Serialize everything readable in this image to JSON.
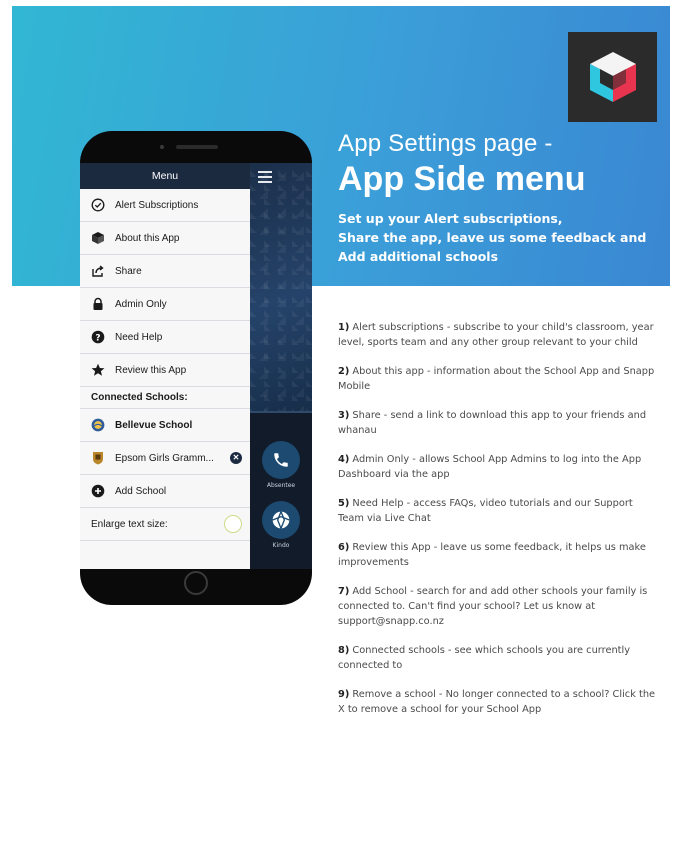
{
  "heading": {
    "subtitle": "App Settings page -",
    "title": "App Side menu",
    "tagline_lines": [
      "Set up your Alert subscriptions,",
      "Share the app, leave us some feedback and",
      "Add additional schools"
    ]
  },
  "logo": {
    "icon": "cube-logo-icon",
    "colors": [
      "#ffffff",
      "#e8344e",
      "#2fc6e0"
    ]
  },
  "phone_menu": {
    "header": "Menu",
    "items": [
      {
        "icon": "check-circle-icon",
        "label": "Alert Subscriptions"
      },
      {
        "icon": "cube-icon",
        "label": "About this App"
      },
      {
        "icon": "share-icon",
        "label": "Share"
      },
      {
        "icon": "lock-icon",
        "label": "Admin Only"
      },
      {
        "icon": "help-icon",
        "label": "Need Help"
      },
      {
        "icon": "star-icon",
        "label": "Review this App"
      }
    ],
    "connected_label": "Connected Schools:",
    "schools": [
      {
        "icon": "school-badge-icon",
        "label": "Bellevue School"
      },
      {
        "icon": "school-crest-icon",
        "label": "Epsom Girls Gramm..."
      }
    ],
    "add_school": "Add School",
    "enlarge_text": "Enlarge text size:"
  },
  "side_buttons": {
    "absentee": "Absentee",
    "kindo": "Kindo"
  },
  "notes": [
    {
      "num": "1)",
      "text": " Alert subscriptions - subscribe to your child's classroom, year level, sports team and any other group relevant to your child"
    },
    {
      "num": "2)",
      "text": " About this app - information about the School App and Snapp Mobile"
    },
    {
      "num": "3)",
      "text": " Share - send a link to download this app to your friends and whanau"
    },
    {
      "num": "4)",
      "text": " Admin Only - allows School App Admins to log into the App Dashboard via the app"
    },
    {
      "num": "5)",
      "text": " Need Help - access FAQs, video tutorials and our Support Team via Live Chat"
    },
    {
      "num": "6)",
      "text": " Review this App - leave us some feedback, it helps us make improvements"
    },
    {
      "num": "7)",
      "text": " Add School - search for and add other schools your family is connected to. Can't find your school? Let us know at support@snapp.co.nz"
    },
    {
      "num": "8)",
      "text": " Connected schools - see which schools you are currently connected to"
    },
    {
      "num": "9)",
      "text": " Remove a school - No longer connected to a school? Click the X to remove a school for your School App"
    }
  ],
  "colors": {
    "banner_start": "#31b7d3",
    "banner_end": "#3a87d2",
    "menu_header": "#1c2a40"
  }
}
